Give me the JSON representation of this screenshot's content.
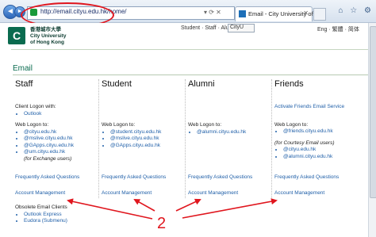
{
  "browser": {
    "address_url": "http://email.cityu.edu.hk/home/",
    "tab_title": "Email - City University of H...",
    "nav_back": "◄",
    "nav_forward": "►",
    "addr_ctrls": "▾ ⟳ ✕",
    "tab_close": "✕",
    "toolbar_icons": [
      "⌂",
      "☆",
      "⚙"
    ]
  },
  "site": {
    "logo_mark": "C",
    "logo_line1": "香港城市大學",
    "logo_line2": "City University",
    "logo_line3": "of Hong Kong",
    "topnav": "Student · Staff · Alumni",
    "select_value": "CityU",
    "lang": "Eng · 繁體 · 简体"
  },
  "page_title": "Email",
  "columns": [
    {
      "head": "Staff",
      "client_label": "Client Logon with:",
      "client_items": [
        "Outlook"
      ],
      "web_label": "Web Logon to:",
      "web_items": [
        "@cityu.edu.hk",
        "@mslive.cityu.edu.hk",
        "@GApps.cityu.edu.hk",
        "@um.cityu.edu.hk"
      ],
      "note": "(for Exchange users)",
      "faq": "Frequently Asked Questions",
      "acct": "Account Management"
    },
    {
      "head": "Student",
      "web_label": "Web Logon to:",
      "web_items": [
        "@student.cityu.edu.hk",
        "@mslive.cityu.edu.hk",
        "@GApps.cityu.edu.hk"
      ],
      "faq": "Frequently Asked Questions",
      "acct": "Account Management"
    },
    {
      "head": "Alumni",
      "web_label": "Web Logon to:",
      "web_items": [
        "@alumni.cityu.edu.hk"
      ],
      "faq": "Frequently Asked Questions",
      "acct": "Account Management"
    },
    {
      "head": "Friends",
      "activate": "Activate Friends Email Service",
      "web_label": "Web Logon to:",
      "web_items": [
        "@friends.cityu.edu.hk"
      ],
      "note": "(for Courtesy Email users)",
      "web_items2": [
        "@cityu.edu.hk",
        "@alumni.cityu.edu.hk"
      ],
      "faq": "Frequently Asked Questions",
      "acct": "Account Management"
    }
  ],
  "obsolete": {
    "label": "Obsolete Email Clients",
    "items": [
      "Outlook Express",
      "Eudora (Submenu)"
    ]
  },
  "annotation": {
    "label": "2",
    "color": "#e0161e"
  }
}
